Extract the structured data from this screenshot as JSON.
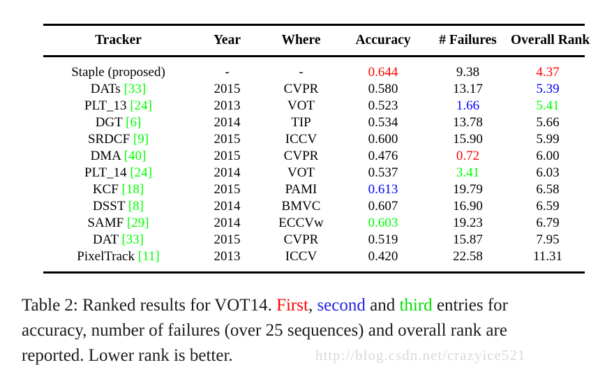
{
  "table": {
    "columns": [
      "Tracker",
      "Year",
      "Where",
      "Accuracy",
      "# Failures",
      "Overall Rank"
    ],
    "rows": [
      {
        "tracker": "Staple (proposed)",
        "cite": "",
        "year": "-",
        "where": "-",
        "accuracy": "0.644",
        "accuracy_color": "red",
        "failures": "9.38",
        "failures_color": "black",
        "rank": "4.37",
        "rank_color": "red"
      },
      {
        "tracker": "DATs",
        "cite": "[33]",
        "year": "2015",
        "where": "CVPR",
        "accuracy": "0.580",
        "accuracy_color": "black",
        "failures": "13.17",
        "failures_color": "black",
        "rank": "5.39",
        "rank_color": "blue"
      },
      {
        "tracker": "PLT_13",
        "cite": "[24]",
        "year": "2013",
        "where": "VOT",
        "accuracy": "0.523",
        "accuracy_color": "black",
        "failures": "1.66",
        "failures_color": "blue",
        "rank": "5.41",
        "rank_color": "green"
      },
      {
        "tracker": "DGT",
        "cite": "[6]",
        "year": "2014",
        "where": "TIP",
        "accuracy": "0.534",
        "accuracy_color": "black",
        "failures": "13.78",
        "failures_color": "black",
        "rank": "5.66",
        "rank_color": "black"
      },
      {
        "tracker": "SRDCF",
        "cite": "[9]",
        "year": "2015",
        "where": "ICCV",
        "accuracy": "0.600",
        "accuracy_color": "black",
        "failures": "15.90",
        "failures_color": "black",
        "rank": "5.99",
        "rank_color": "black"
      },
      {
        "tracker": "DMA",
        "cite": "[40]",
        "year": "2015",
        "where": "CVPR",
        "accuracy": "0.476",
        "accuracy_color": "black",
        "failures": "0.72",
        "failures_color": "red",
        "rank": "6.00",
        "rank_color": "black"
      },
      {
        "tracker": "PLT_14",
        "cite": "[24]",
        "year": "2014",
        "where": "VOT",
        "accuracy": "0.537",
        "accuracy_color": "black",
        "failures": "3.41",
        "failures_color": "green",
        "rank": "6.03",
        "rank_color": "black"
      },
      {
        "tracker": "KCF",
        "cite": "[18]",
        "year": "2015",
        "where": "PAMI",
        "accuracy": "0.613",
        "accuracy_color": "blue",
        "failures": "19.79",
        "failures_color": "black",
        "rank": "6.58",
        "rank_color": "black"
      },
      {
        "tracker": "DSST",
        "cite": "[8]",
        "year": "2014",
        "where": "BMVC",
        "accuracy": "0.607",
        "accuracy_color": "black",
        "failures": "16.90",
        "failures_color": "black",
        "rank": "6.59",
        "rank_color": "black"
      },
      {
        "tracker": "SAMF",
        "cite": "[29]",
        "year": "2014",
        "where": "ECCVw",
        "accuracy": "0.603",
        "accuracy_color": "green",
        "failures": "19.23",
        "failures_color": "black",
        "rank": "6.79",
        "rank_color": "black"
      },
      {
        "tracker": "DAT",
        "cite": "[33]",
        "year": "2015",
        "where": "CVPR",
        "accuracy": "0.519",
        "accuracy_color": "black",
        "failures": "15.87",
        "failures_color": "black",
        "rank": "7.95",
        "rank_color": "black"
      },
      {
        "tracker": "PixelTrack",
        "cite": "[11]",
        "year": "2013",
        "where": "ICCV",
        "accuracy": "0.420",
        "accuracy_color": "black",
        "failures": "22.58",
        "failures_color": "black",
        "rank": "11.31",
        "rank_color": "black"
      }
    ]
  },
  "caption": {
    "label": "Table 2:",
    "part1": " Ranked results for VOT14. ",
    "first": "First",
    "comma": ", ",
    "second": "second",
    "and": " and ",
    "third": "third",
    "part2": " entries for accuracy, number of failures (over 25 sequences) and overall rank are reported. Lower rank is better."
  },
  "watermark": {
    "text": "http://blog.csdn.net/crazyice521"
  },
  "colors": {
    "first": "#ff0000",
    "second": "#0000ff",
    "third": "#00ff00",
    "text": "#000000",
    "rule": "#000000"
  }
}
